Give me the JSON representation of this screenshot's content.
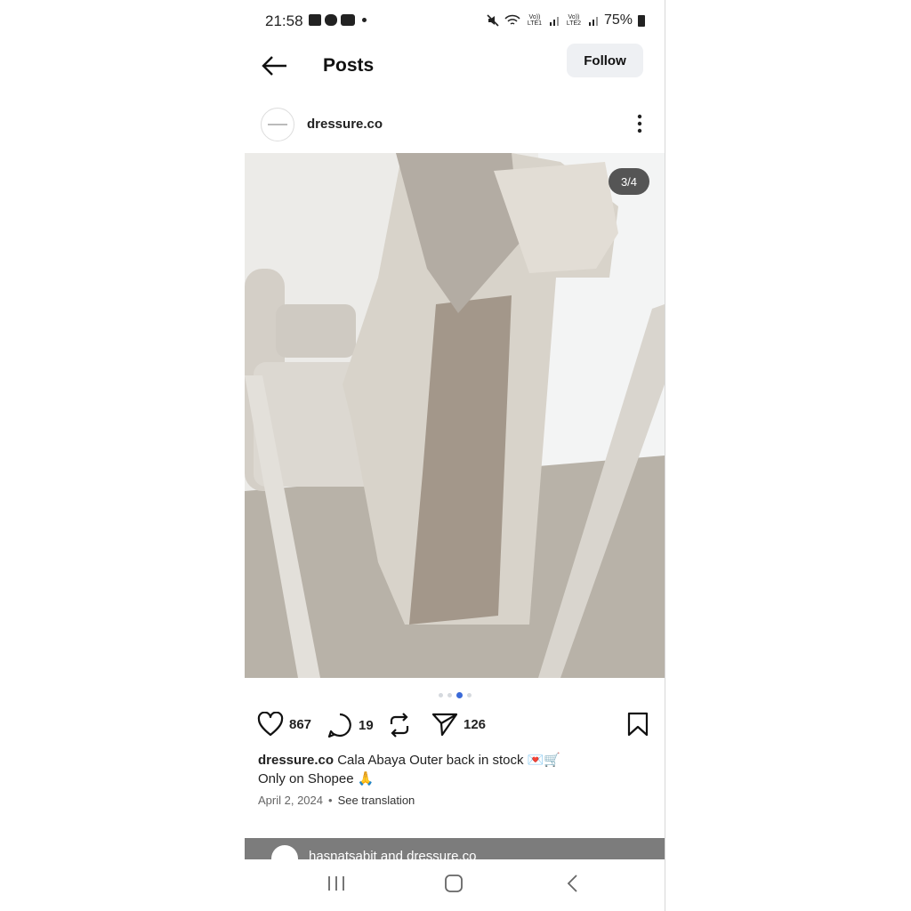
{
  "status_bar": {
    "time": "21:58",
    "lte1": "Vo)) LTE1",
    "lte2": "Vo)) LTE2",
    "battery": "75%"
  },
  "header": {
    "title": "Posts",
    "follow_label": "Follow"
  },
  "post": {
    "author": "dressure.co",
    "page_indicator": "3/4",
    "carousel": {
      "count": 4,
      "active_index": 2
    },
    "likes": "867",
    "comments": "19",
    "shares": "126",
    "caption_user": "dressure.co",
    "caption_line1": "Cala Abaya Outer back in stock 💌🛒",
    "caption_line2": "Only on Shopee 🙏",
    "date": "April 2, 2024",
    "see_translation": "See translation"
  },
  "next_post": {
    "text": "hasnatsabit and dressure.co"
  },
  "colors": {
    "accent_dot": "#3a6ad8",
    "follow_bg": "#eef0f3"
  }
}
